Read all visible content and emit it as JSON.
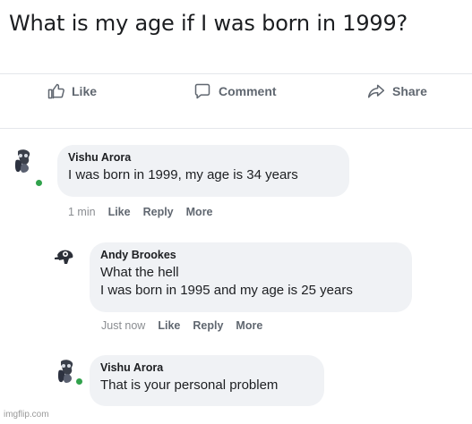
{
  "post": {
    "text": "What is my age if I was born in 1999?"
  },
  "actions": {
    "like_label": "Like",
    "comment_label": "Comment",
    "share_label": "Share"
  },
  "comments": [
    {
      "author": "Vishu Arora",
      "lines": [
        "I was born in 1999, my age is 34 years"
      ],
      "time": "1 min",
      "like_label": "Like",
      "reply_label": "Reply",
      "more_label": "More"
    },
    {
      "author": "Andy Brookes",
      "lines": [
        "What the hell",
        "I was born in 1995 and my age is 25 years"
      ],
      "time": "Just now",
      "like_label": "Like",
      "reply_label": "Reply",
      "more_label": "More"
    },
    {
      "author": "Vishu Arora",
      "lines": [
        "That is your personal problem"
      ]
    }
  ],
  "watermark": "imgflip.com",
  "colors": {
    "bubble": "#f0f2f5",
    "meta_text": "#606770",
    "online": "#31a24c"
  }
}
